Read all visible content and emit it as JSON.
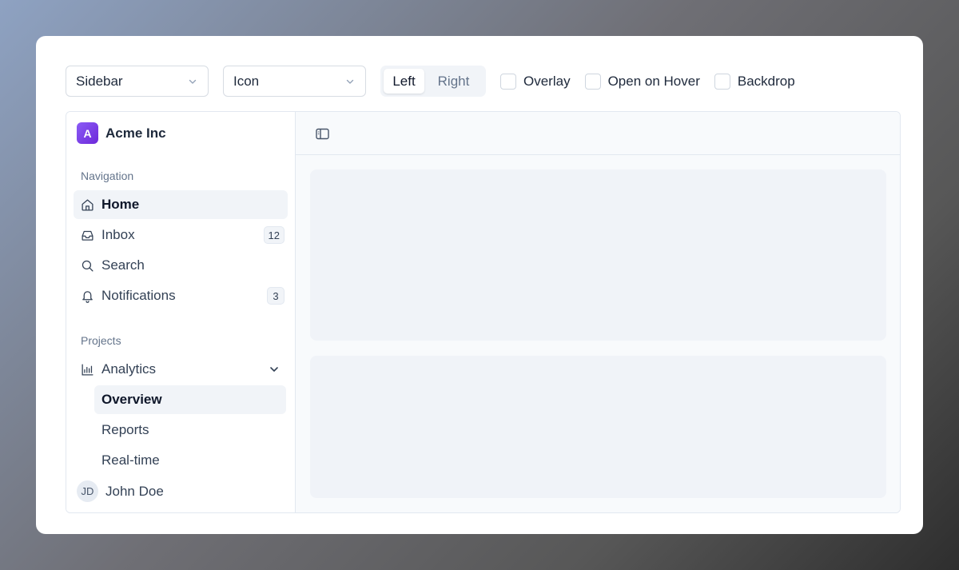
{
  "controls": {
    "variant_select": {
      "value": "Sidebar"
    },
    "collapsible_select": {
      "value": "Icon"
    },
    "side_toggle": {
      "left": "Left",
      "right": "Right",
      "selected": "Left"
    },
    "checkboxes": [
      {
        "label": "Overlay",
        "checked": false
      },
      {
        "label": "Open on Hover",
        "checked": false
      },
      {
        "label": "Backdrop",
        "checked": false
      }
    ]
  },
  "sidebar": {
    "brand": {
      "logo_letter": "A",
      "name": "Acme Inc",
      "logo_color": "#7c3aed"
    },
    "navigation_label": "Navigation",
    "nav_items": [
      {
        "label": "Home",
        "icon": "home-icon",
        "active": true
      },
      {
        "label": "Inbox",
        "icon": "inbox-icon",
        "badge": "12"
      },
      {
        "label": "Search",
        "icon": "search-icon"
      },
      {
        "label": "Notifications",
        "icon": "bell-icon",
        "badge": "3"
      }
    ],
    "projects_label": "Projects",
    "project": {
      "label": "Analytics",
      "icon": "bar-chart-icon",
      "expanded": true,
      "sub_items": [
        {
          "label": "Overview",
          "active": true
        },
        {
          "label": "Reports"
        },
        {
          "label": "Real-time"
        }
      ]
    },
    "user": {
      "initials": "JD",
      "name": "John Doe"
    }
  },
  "main": {
    "toggle_icon": "sidebar-toggle-icon"
  }
}
